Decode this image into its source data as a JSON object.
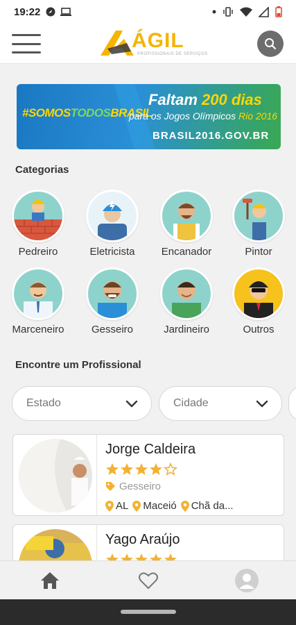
{
  "status_bar": {
    "time": "19:22",
    "icons_left": [
      "navigation-dot-icon",
      "laptop-icon"
    ],
    "icons_right": [
      "dot-icon",
      "vibrate-icon",
      "wifi-icon",
      "signal-icon",
      "battery-low-icon"
    ]
  },
  "header": {
    "logo_text": "ÁGIL",
    "logo_tagline": "PROFISSIONAIS DE SERVIÇOS",
    "menu_icon": "hamburger-icon",
    "search_icon": "search-icon"
  },
  "banner": {
    "hashtag_a": "#SOMOS",
    "hashtag_b": "TODOS",
    "hashtag_c": "BRASIL",
    "line1_a": "Faltam",
    "line1_b": "200 dias",
    "line2_a": "para os Jogos Olímpicos",
    "line2_b": "Rio 2016",
    "line3": "BRASIL2016.GOV.BR"
  },
  "categories_title": "Categorias",
  "categories": [
    {
      "label": "Pedreiro"
    },
    {
      "label": "Eletricista"
    },
    {
      "label": "Encanador"
    },
    {
      "label": "Pintor"
    },
    {
      "label": "Marceneiro"
    },
    {
      "label": "Gesseiro"
    },
    {
      "label": "Jardineiro"
    },
    {
      "label": "Outros"
    }
  ],
  "find_title": "Encontre um Profissional",
  "filters": {
    "state_placeholder": "Estado",
    "city_placeholder": "Cidade"
  },
  "professionals": [
    {
      "name": "Jorge Caldeira",
      "rating": 4,
      "max_rating": 5,
      "category": "Gesseiro",
      "state": "AL",
      "city": "Maceió",
      "district": "Chã da..."
    },
    {
      "name": "Yago Araújo",
      "rating": 5,
      "max_rating": 5
    }
  ],
  "colors": {
    "accent": "#f5b400",
    "teal": "#8ed3cb",
    "star": "#f2b233"
  },
  "bottom_nav": [
    "home-icon",
    "heart-icon",
    "profile-icon"
  ]
}
